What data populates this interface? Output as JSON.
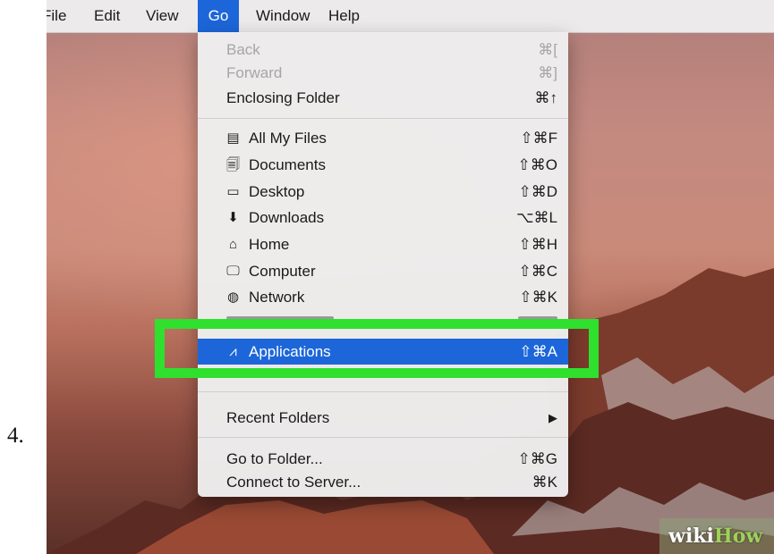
{
  "step": "4.",
  "menubar": {
    "items": [
      {
        "label": "File"
      },
      {
        "label": "Edit"
      },
      {
        "label": "View"
      },
      {
        "label": "Go",
        "active": true
      },
      {
        "label": "Window"
      },
      {
        "label": "Help"
      }
    ]
  },
  "go_menu": {
    "back": {
      "label": "Back",
      "shortcut": "⌘[",
      "enabled": false
    },
    "forward": {
      "label": "Forward",
      "shortcut": "⌘]",
      "enabled": false
    },
    "enclosing_folder": {
      "label": "Enclosing Folder",
      "shortcut": "⌘↑"
    },
    "places": [
      {
        "label": "All My Files",
        "shortcut": "⇧⌘F",
        "icon": "all-files-icon",
        "glyph": "▤"
      },
      {
        "label": "Documents",
        "shortcut": "⇧⌘O",
        "icon": "documents-icon",
        "glyph": "🗐"
      },
      {
        "label": "Desktop",
        "shortcut": "⇧⌘D",
        "icon": "desktop-icon",
        "glyph": "▭"
      },
      {
        "label": "Downloads",
        "shortcut": "⌥⌘L",
        "icon": "downloads-icon",
        "glyph": "⬇"
      },
      {
        "label": "Home",
        "shortcut": "⇧⌘H",
        "icon": "home-icon",
        "glyph": "⌂"
      },
      {
        "label": "Computer",
        "shortcut": "⇧⌘C",
        "icon": "computer-icon",
        "glyph": "🖵"
      },
      {
        "label": "Network",
        "shortcut": "⇧⌘K",
        "icon": "network-icon",
        "glyph": "◍"
      }
    ],
    "applications": {
      "label": "Applications",
      "shortcut": "⇧⌘A",
      "icon": "applications-icon",
      "glyph": "⩘",
      "highlighted": true
    },
    "recent_folders": {
      "label": "Recent Folders",
      "submenu_arrow": "▶"
    },
    "go_to_folder": {
      "label": "Go to Folder...",
      "shortcut": "⇧⌘G"
    },
    "connect_to_server": {
      "label": "Connect to Server...",
      "shortcut": "⌘K"
    }
  },
  "watermark": {
    "part1": "wiki",
    "part2": "How"
  },
  "colors": {
    "highlight_box": "#2fe02f",
    "selection_blue": "#1c66d9",
    "menu_background": "#eeeeee",
    "disabled_text": "#a6a6a6"
  }
}
